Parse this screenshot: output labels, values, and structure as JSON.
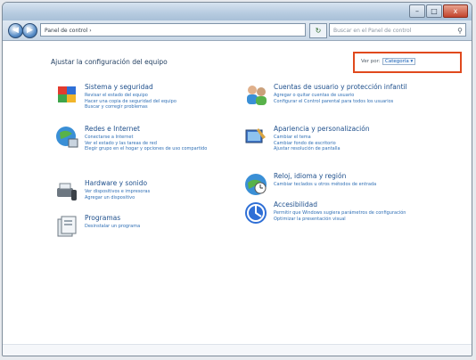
{
  "window": {
    "address": "Panel de control ›",
    "search_placeholder": "Buscar en el Panel de control",
    "controls": {
      "minimize": "–",
      "maximize": "□",
      "close": "x"
    }
  },
  "header": {
    "title": "Ajustar la configuración del equipo",
    "view_by_label": "Ver por:",
    "view_by_value": "Categoría ▾"
  },
  "categories": [
    {
      "title": "Sistema y seguridad",
      "icon": "shield-icon",
      "links": [
        "Revisar el estado del equipo",
        "Hacer una copia de seguridad del equipo",
        "Buscar y corregir problemas"
      ]
    },
    {
      "title": "Redes e Internet",
      "icon": "network-globe-icon",
      "links": [
        "Conectarse a Internet",
        "Ver el estado y las tareas de red",
        "Elegir grupo en el hogar y opciones de uso compartido"
      ]
    },
    {
      "title": "Hardware y sonido",
      "icon": "printer-speaker-icon",
      "links": [
        "Ver dispositivos e impresoras",
        "Agregar un dispositivo"
      ]
    },
    {
      "title": "Programas",
      "icon": "programs-icon",
      "links": [
        "Desinstalar un programa"
      ]
    },
    {
      "title": "Cuentas de usuario y protección infantil",
      "icon": "users-icon",
      "links": [
        "Agregar o quitar cuentas de usuario",
        "Configurar el Control parental para todos los usuarios"
      ]
    },
    {
      "title": "Apariencia y personalización",
      "icon": "appearance-icon",
      "links": [
        "Cambiar el tema",
        "Cambiar fondo de escritorio",
        "Ajustar resolución de pantalla"
      ]
    },
    {
      "title": "Reloj, idioma y región",
      "icon": "clock-globe-icon",
      "links": [
        "Cambiar teclados u otros métodos de entrada"
      ]
    },
    {
      "title": "Accesibilidad",
      "icon": "accessibility-icon",
      "links": [
        "Permitir que Windows sugiera parámetros de configuración",
        "Optimizar la presentación visual"
      ]
    }
  ],
  "colors": {
    "accent_highlight": "#e0491d",
    "link": "#2f6fb5",
    "title_link": "#1e4f8c"
  }
}
